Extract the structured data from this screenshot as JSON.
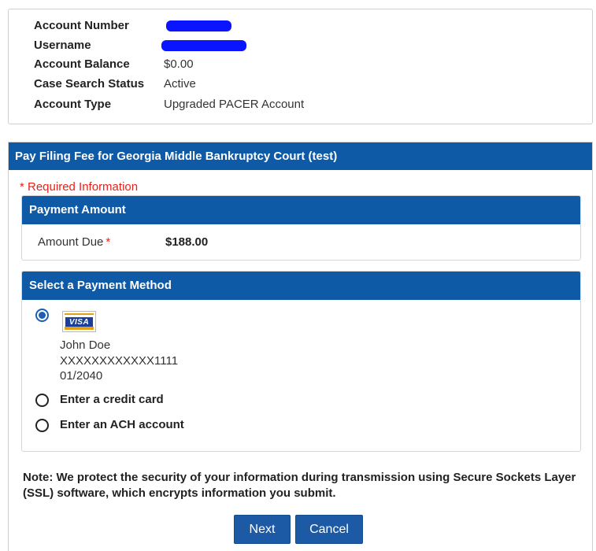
{
  "account": {
    "rows": [
      {
        "label": "Account Number",
        "value": ""
      },
      {
        "label": "Username",
        "value": ""
      },
      {
        "label": "Account Balance",
        "value": "$0.00"
      },
      {
        "label": "Case Search Status",
        "value": "Active"
      },
      {
        "label": "Account Type",
        "value": "Upgraded PACER Account"
      }
    ],
    "redaction_color": "#0a14ff"
  },
  "main": {
    "title": "Pay Filing Fee for Georgia Middle Bankruptcy Court (test)",
    "required_note": "* Required Information",
    "payment_amount": {
      "title": "Payment Amount",
      "label": "Amount Due",
      "required_marker": "*",
      "value": "$188.00"
    },
    "payment_method": {
      "title": "Select a Payment Method",
      "saved_card": {
        "brand": "VISA",
        "brand_icon": "visa-card-icon",
        "name": "John Doe",
        "number": "XXXXXXXXXXXX1111",
        "expiry": "01/2040",
        "selected": true
      },
      "options": [
        {
          "label": "Enter a credit card",
          "selected": false
        },
        {
          "label": "Enter an ACH account",
          "selected": false
        }
      ]
    },
    "ssl_note": "Note: We protect the security of your information during transmission using Secure Sockets Layer (SSL) software, which encrypts information you submit."
  },
  "buttons": {
    "next": "Next",
    "cancel": "Cancel"
  },
  "colors": {
    "header_blue": "#0e5aa7",
    "button_blue": "#1c5aa6",
    "required_red": "#e8211c"
  }
}
